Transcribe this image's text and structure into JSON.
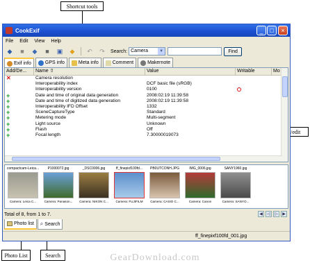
{
  "callouts": {
    "shortcut_tools": "Shortcut tools",
    "main_view_edit": "Main view/edit",
    "photo_list": "Photo List",
    "search": "Search"
  },
  "window": {
    "title": "CookExif",
    "minimize": "_",
    "maximize": "□",
    "close": "×"
  },
  "menu": [
    "File",
    "Edit",
    "View",
    "Help"
  ],
  "toolbar": {
    "search_label": "Search:",
    "search_field_value": "Camera",
    "search_input_value": "",
    "find_label": "Find"
  },
  "tabs": [
    "Exif info",
    "GPS info",
    "Meta info",
    "Comment",
    "Makernote"
  ],
  "grid": {
    "columns": [
      "Add/De...",
      "Name",
      "Value",
      "Writable",
      "Mo"
    ],
    "rows": [
      {
        "mark": "x",
        "name": "Camera resolution",
        "value": "",
        "writable": ""
      },
      {
        "mark": "",
        "name": "Interoperability index",
        "value": "DCF basic file (sRGB)",
        "writable": ""
      },
      {
        "mark": "",
        "name": "Interoperability version",
        "value": "0100",
        "writable": "no"
      },
      {
        "mark": "+",
        "name": "Date and time of original data generation",
        "value": "2008:02:19 11:39:58",
        "writable": ""
      },
      {
        "mark": "+",
        "name": "Date and time of digitized data generation",
        "value": "2008:02:19 11:39:58",
        "writable": ""
      },
      {
        "mark": "+",
        "name": "Interoperability IFD Offset",
        "value": "1332",
        "writable": ""
      },
      {
        "mark": "+",
        "name": "SceneCaptureType",
        "value": "Standard",
        "writable": ""
      },
      {
        "mark": "+",
        "name": "Metering mode",
        "value": "Multi-segment",
        "writable": ""
      },
      {
        "mark": "+",
        "name": "Light source",
        "value": "Unknown",
        "writable": ""
      },
      {
        "mark": "+",
        "name": "Flash",
        "value": "Off",
        "writable": ""
      },
      {
        "mark": "+",
        "name": "Focal length",
        "value": "7.30000019073",
        "writable": ""
      }
    ]
  },
  "photos": [
    {
      "file": "compactcam-Leica...",
      "camera": "Camera: Leica C...",
      "color1": "#9a9a90",
      "color2": "#c7c2b0"
    },
    {
      "file": "P1000072.jpg",
      "camera": "Camera: Panason...",
      "color1": "#6aa0d8",
      "color2": "#3f6b2b"
    },
    {
      "file": "_DSC0006.jpg",
      "camera": "Camera: NIKON C...",
      "color1": "#9b7d43",
      "color2": "#3b3122"
    },
    {
      "file": "ff_finepixf100fd...",
      "camera": "Camera: FUJIFILM",
      "color1": "#5d8fcc",
      "color2": "#a8cbe9"
    },
    {
      "file": "PB0UTCONH.JPG",
      "camera": "Camera: CASIO C...",
      "color1": "#7b5a3c",
      "color2": "#d8c4b0"
    },
    {
      "file": "IMG_0006.jpg",
      "camera": "Camera: Canon",
      "color1": "#b33b3b",
      "color2": "#2f6a2c"
    },
    {
      "file": "SANY1960.jpg",
      "camera": "Camera: SANYO...",
      "color1": "#8f8f8f",
      "color2": "#4a4a4a"
    }
  ],
  "status": {
    "total": "Total of 8, from 1 to 7."
  },
  "bottom_tabs": [
    "Photo list",
    "Search"
  ],
  "statusbar": {
    "file": "ff_finepixf100fd_001.jpg"
  },
  "watermark": "GearDownload.com"
}
